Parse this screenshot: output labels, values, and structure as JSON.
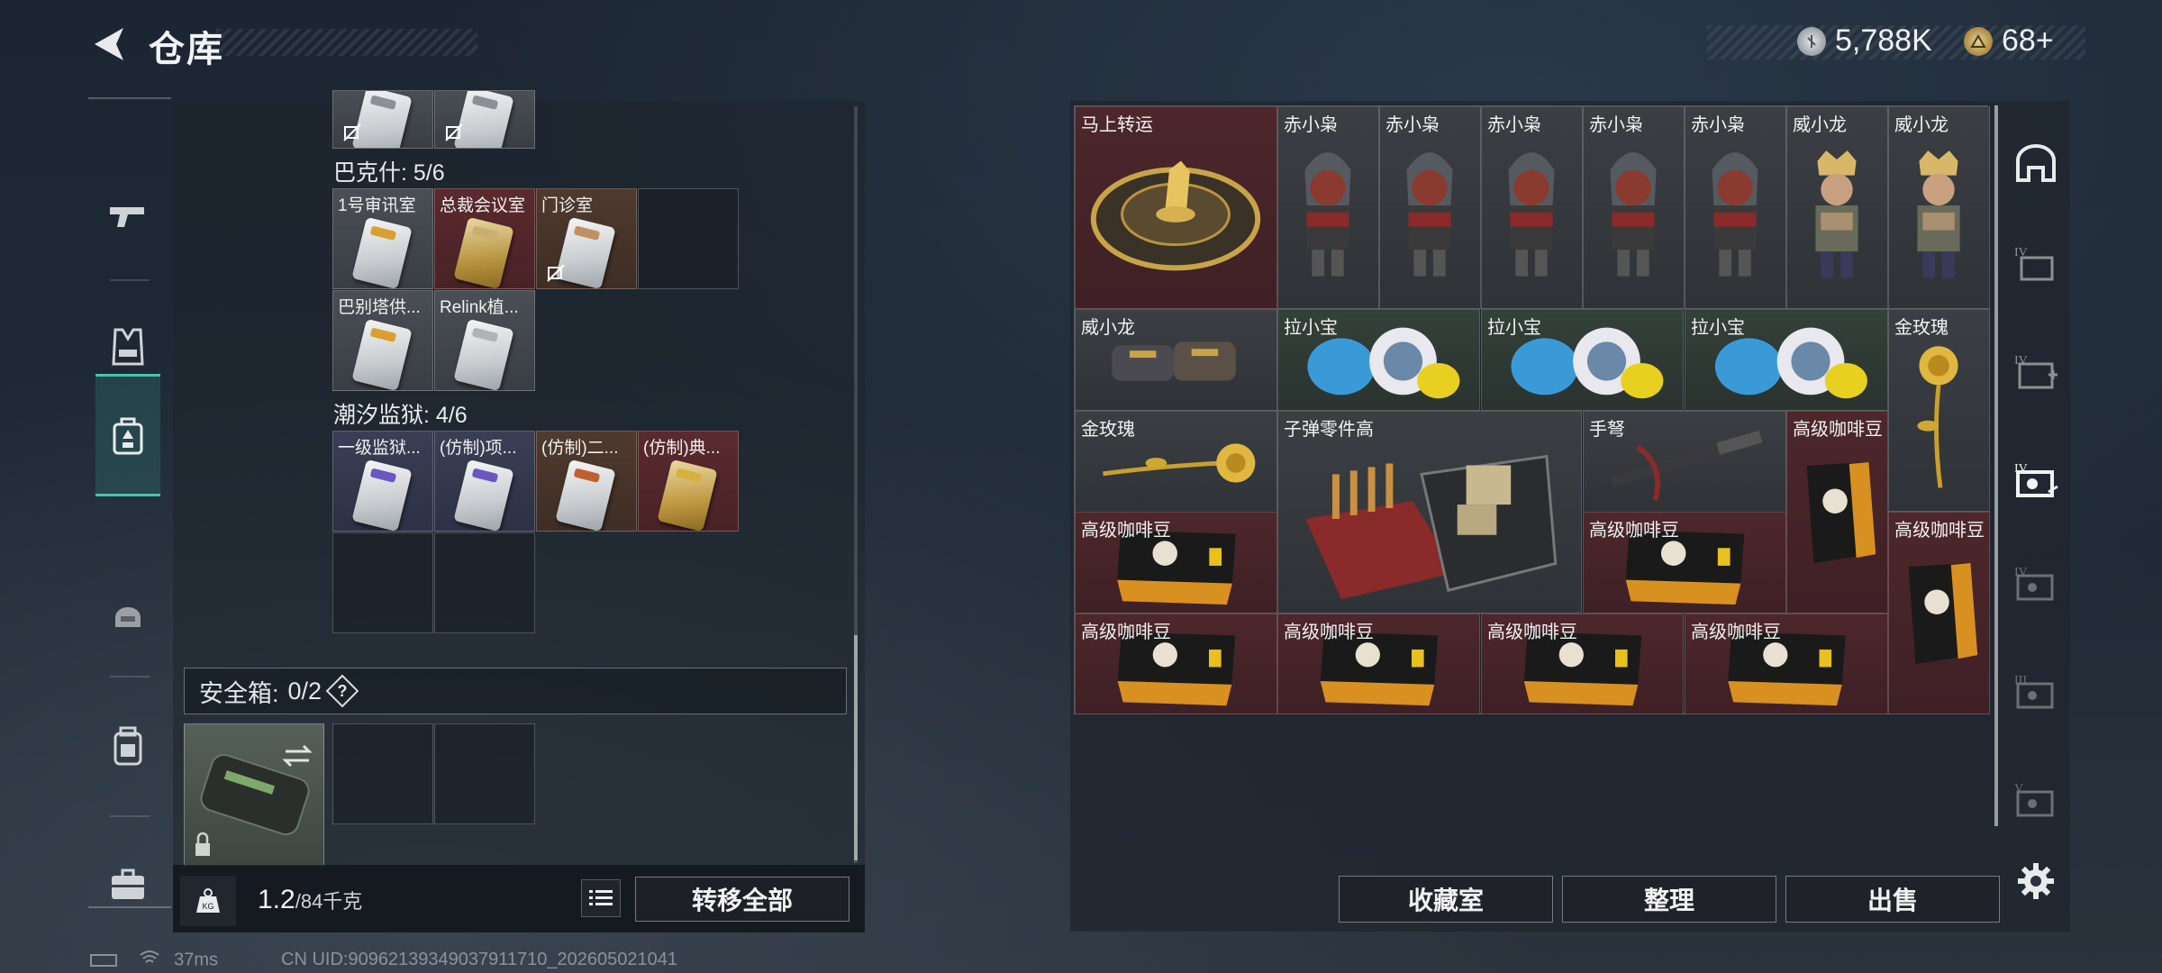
{
  "header": {
    "title": "仓库",
    "currencies": [
      {
        "icon": "silver-coin-icon",
        "value": "5,788K"
      },
      {
        "icon": "gold-triangle-coin-icon",
        "value": "68+"
      }
    ]
  },
  "left_nav": {
    "items": [
      {
        "name": "weapons",
        "icon": "gun-icon"
      },
      {
        "name": "armor",
        "icon": "vest-icon"
      },
      {
        "name": "keys",
        "icon": "keycard-bag-icon",
        "active": true
      },
      {
        "name": "helmet",
        "icon": "helmet-icon"
      },
      {
        "name": "backpack",
        "icon": "backpack-icon"
      },
      {
        "name": "case",
        "icon": "briefcase-icon"
      }
    ]
  },
  "key_storage": {
    "groups": [
      {
        "label": "巴克什: 5/6",
        "slots": [
          "1号审讯室",
          "总裁会议室",
          "门诊室",
          "",
          "巴别塔供...",
          "Relink植..."
        ]
      },
      {
        "label": "潮汐监狱: 4/6",
        "slots": [
          "一级监狱...",
          "(仿制)项...",
          "(仿制)二...",
          "(仿制)典...",
          "",
          ""
        ]
      }
    ],
    "safe_box": {
      "label": "安全箱:",
      "count": "0/2",
      "help": "?"
    }
  },
  "bottom_bar": {
    "weight_icon": "KG",
    "weight_current": "1.2",
    "weight_max": "/84千克",
    "transfer_all": "转移全部"
  },
  "stash": {
    "items": [
      {
        "label": "马上转运",
        "color": "red"
      },
      {
        "label": "赤小枭",
        "color": "gray"
      },
      {
        "label": "赤小枭",
        "color": "gray"
      },
      {
        "label": "赤小枭",
        "color": "gray"
      },
      {
        "label": "赤小枭",
        "color": "gray"
      },
      {
        "label": "赤小枭",
        "color": "gray"
      },
      {
        "label": "威小龙",
        "color": "gray"
      },
      {
        "label": "威小龙",
        "color": "gray"
      },
      {
        "label": "威小龙",
        "color": "gray"
      },
      {
        "label": "拉小宝",
        "color": "green"
      },
      {
        "label": "拉小宝",
        "color": "green"
      },
      {
        "label": "拉小宝",
        "color": "green"
      },
      {
        "label": "金玫瑰",
        "color": "gray"
      },
      {
        "label": "金玫瑰",
        "color": "gray"
      },
      {
        "label": "子弹零件高",
        "color": "gray"
      },
      {
        "label": "手弩",
        "color": "gray"
      },
      {
        "label": "高级咖啡豆",
        "color": "red"
      },
      {
        "label": "高级咖啡豆",
        "color": "red"
      },
      {
        "label": "高级咖啡豆",
        "color": "red"
      },
      {
        "label": "高级咖啡豆",
        "color": "red"
      },
      {
        "label": "高级咖啡豆",
        "color": "red"
      },
      {
        "label": "高级咖啡豆",
        "color": "red"
      },
      {
        "label": "高级咖啡豆",
        "color": "red"
      },
      {
        "label": "高级咖啡豆",
        "color": "red"
      }
    ]
  },
  "right_buttons": {
    "collection": "收藏室",
    "sort": "整理",
    "sell": "出售"
  },
  "right_nav": {
    "items": [
      "home-icon",
      "tier-4-case-icon",
      "tier-4-medkit-icon",
      "tier-4-key-icon",
      "tier-4-key-icon",
      "tier-3-key-icon",
      "tier-5-key-icon",
      "settings-gear-icon"
    ]
  },
  "status_bar": {
    "ping": "37ms",
    "uid": "CN UID:90962139349037911710_202605021041"
  },
  "colors": {
    "accent_teal": "#3fc7b0",
    "rare_red": "#4d272c",
    "panel": "#1c2633"
  }
}
